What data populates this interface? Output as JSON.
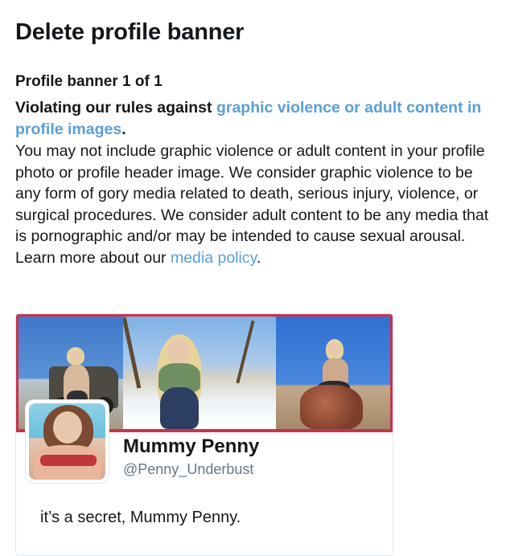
{
  "page": {
    "title": "Delete profile banner",
    "banner_count": "Profile banner 1 of 1"
  },
  "violation": {
    "prefix": "Violating our rules against ",
    "rule_link": "graphic violence or adult content in profile images",
    "suffix": "."
  },
  "policy": {
    "text": "You may not include graphic violence or adult content in your profile photo or profile header image. We consider graphic violence to be any form of gory media related to death, serious injury, violence, or surgical procedures. We consider adult content to be any media that is pornographic and/or may be intended to cause sexual arousal. Learn more about our ",
    "link": "media policy",
    "suffix": "."
  },
  "profile": {
    "display_name": "Mummy Penny",
    "handle": "@Penny_Underbust",
    "bio": "it’s a secret, Mummy Penny."
  },
  "colors": {
    "link": "#5a9fd4",
    "banner_border": "#c9334d",
    "text": "#14171a",
    "secondary_text": "#657786"
  }
}
